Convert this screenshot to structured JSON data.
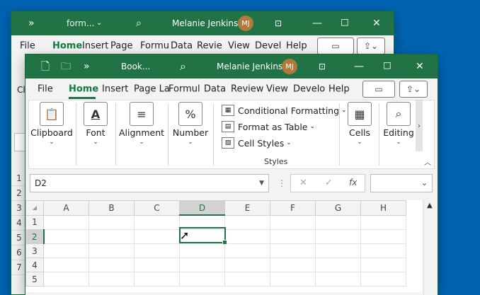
{
  "back_window": {
    "title": "form...",
    "user_name": "Melanie Jenkins",
    "user_initials": "MJ",
    "menu": [
      "File",
      "Home",
      "Insert",
      "Page",
      "Formu",
      "Data",
      "Revie",
      "View",
      "Devel",
      "Help"
    ],
    "row_numbers": [
      "1",
      "2",
      "3",
      "4",
      "5",
      "6",
      "7"
    ],
    "left_fragment": "Cl"
  },
  "front_window": {
    "title": "Book...",
    "user_name": "Melanie Jenkins",
    "user_initials": "MJ",
    "menu": [
      "File",
      "Home",
      "Insert",
      "Page La",
      "Formul",
      "Data",
      "Review",
      "View",
      "Develo",
      "Help"
    ],
    "active_menu": "Home",
    "ribbon": {
      "clipboard": "Clipboard",
      "font": "Font",
      "alignment": "Alignment",
      "number": "Number",
      "number_icon": "%",
      "conditional_formatting": "Conditional Formatting",
      "format_as_table": "Format as Table",
      "cell_styles": "Cell Styles",
      "styles_group": "Styles",
      "cells": "Cells",
      "editing": "Editing"
    },
    "formula_bar": {
      "name_box": "D2",
      "fx": "fx"
    },
    "columns": [
      "A",
      "B",
      "C",
      "D",
      "E",
      "F",
      "G",
      "H"
    ],
    "rows": [
      "1",
      "2",
      "3",
      "4",
      "5"
    ],
    "selected_cell": "D2"
  },
  "colors": {
    "excel_green": "#217346",
    "desktop_blue": "#0063b1"
  }
}
